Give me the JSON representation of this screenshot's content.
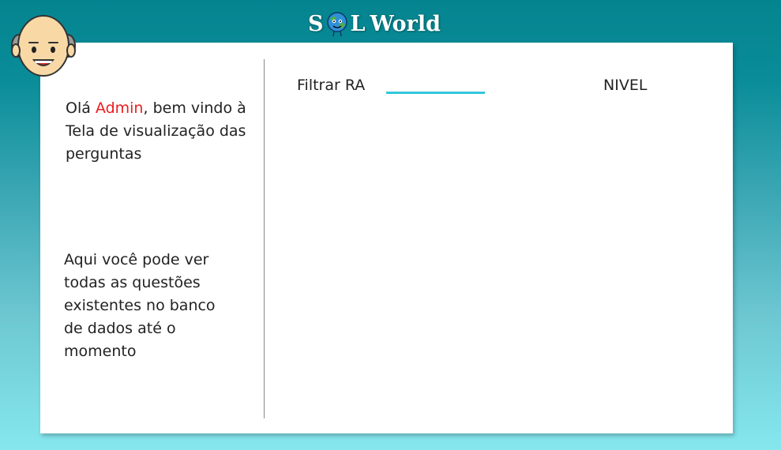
{
  "brand": {
    "prefix": "S",
    "icon": "globe-o-icon",
    "suffix": "L",
    "word": "World"
  },
  "avatar": {
    "icon": "old-man-avatar-icon"
  },
  "welcome": {
    "greeting": "Olá ",
    "user": "Admin",
    "rest": ", bem vindo à Tela de visualização das perguntas"
  },
  "info": {
    "text": "Aqui você pode ver todas as questões existentes no banco de dados até o momento"
  },
  "filter": {
    "label": "Filtrar RA",
    "value": "",
    "placeholder": ""
  },
  "nivel": {
    "label": "NIVEL"
  },
  "colors": {
    "accent": "#33c6dc",
    "highlight": "#e81e1e"
  }
}
